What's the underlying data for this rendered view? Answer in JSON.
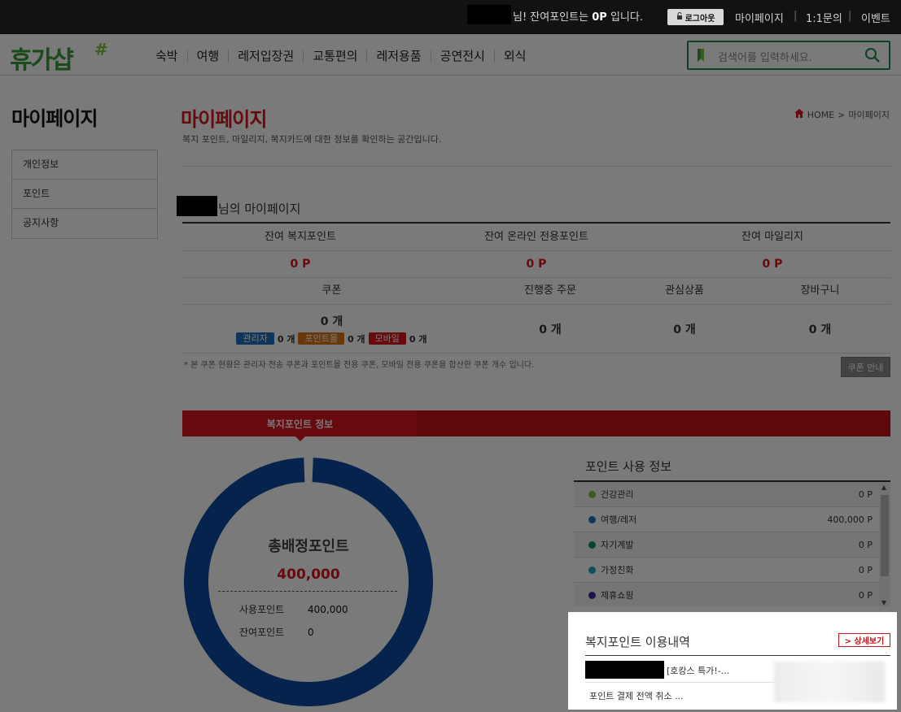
{
  "topbar": {
    "greeting": "님! 잔여포인트는",
    "points": "0P",
    "greeting_end": "입니다.",
    "logout_label": "로그아웃",
    "links": [
      "마이페이지",
      "1:1문의",
      "이벤트"
    ]
  },
  "header": {
    "logo_text": "휴가샵",
    "nav": [
      "숙박",
      "여행",
      "레저입장권",
      "교통편의",
      "레저용품",
      "공연전시",
      "외식"
    ],
    "search_placeholder": "검색어를 입력하세요."
  },
  "sidebar": {
    "title": "마이페이지",
    "items": [
      "개인정보",
      "포인트",
      "공지사항"
    ]
  },
  "page": {
    "title": "마이페이지",
    "description": "복지 포인트, 마일리지, 복지카드에 대한 정보를 확인하는 공간입니다.",
    "breadcrumb_home": "HOME",
    "breadcrumb_current": "마이페이지",
    "user_heading": "님의 마이페이지"
  },
  "summary": {
    "headers": [
      "잔여 복지포인트",
      "잔여 온라인 전용포인트",
      "잔여 마일리지"
    ],
    "values": [
      "0 P",
      "0 P",
      "0 P"
    ],
    "headers2": [
      "쿠폰",
      "진행중 주문",
      "관심상품",
      "장바구니"
    ],
    "coupon_total": "0 개",
    "coupon_types": [
      {
        "label": "관리자",
        "count": "0 개",
        "color": "#1f6fbf"
      },
      {
        "label": "포인트몰",
        "count": "0 개",
        "color": "#d9741a"
      },
      {
        "label": "모바일",
        "count": "0 개",
        "color": "#d7141c"
      }
    ],
    "orders": "0 개",
    "wishlist": "0 개",
    "cart": "0 개",
    "note": "* 본 쿠폰 현황은 관리자 전송 쿠폰과 포인트몰 전용 쿠폰, 모바일 전용 쿠폰을 합산한 쿠폰 개수 입니다.",
    "coupon_button": "쿠폰 안내"
  },
  "tab": {
    "active_label": "복지포인트 정보"
  },
  "donut": {
    "title": "총배정포인트",
    "total": "400,000",
    "used_label": "사용포인트",
    "used_value": "400,000",
    "remain_label": "잔여포인트",
    "remain_value": "0",
    "used_fraction": 1.0,
    "color": "#0b4aa2"
  },
  "usage": {
    "title": "포인트 사용 정보",
    "rows": [
      {
        "name": "건강관리",
        "value": "0 P",
        "color": "#7cc242"
      },
      {
        "name": "여행/레저",
        "value": "400,000 P",
        "color": "#1f6fbf"
      },
      {
        "name": "자기계발",
        "value": "0 P",
        "color": "#1a8a5c"
      },
      {
        "name": "가정친화",
        "value": "0 P",
        "color": "#1aa7c9"
      },
      {
        "name": "제휴쇼핑",
        "value": "0 P",
        "color": "#3b2a9e"
      }
    ]
  },
  "history": {
    "title": "복지포인트 이용내역",
    "more_label": "> 상세보기",
    "row1": "[호캉스 특가!-...",
    "row2": "포인트 결제 전액 취소 ..."
  }
}
